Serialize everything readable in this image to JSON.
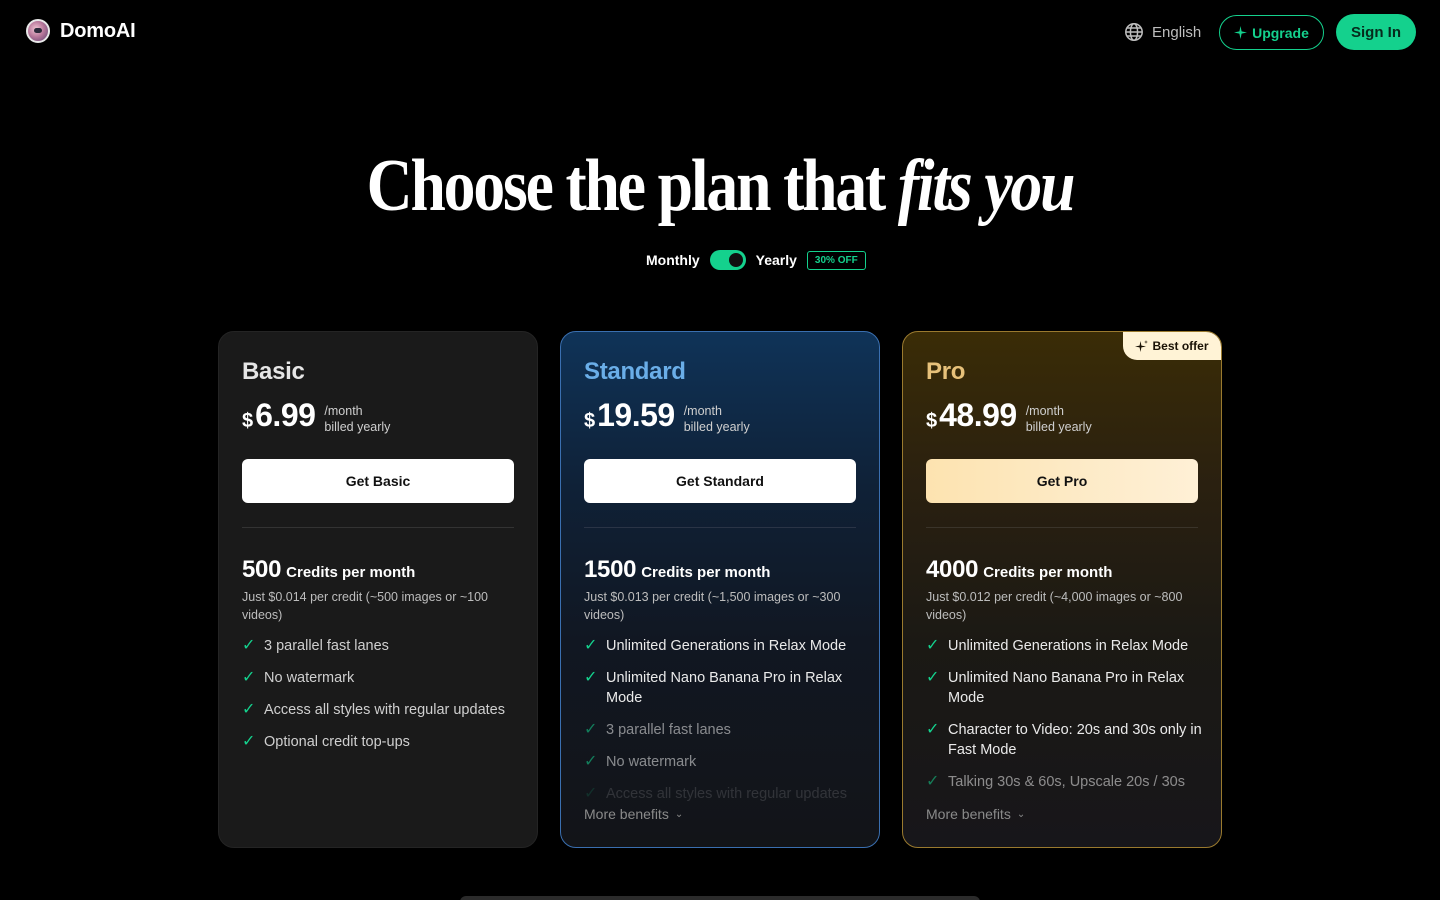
{
  "header": {
    "brand": "DomoAI",
    "language": "English",
    "upgrade_label": "Upgrade",
    "signin_label": "Sign In"
  },
  "hero": {
    "title_plain": "Choose the plan that ",
    "title_italic": "fits you"
  },
  "billing": {
    "monthly_label": "Monthly",
    "yearly_label": "Yearly",
    "discount_badge": "30% OFF",
    "yearly_selected": true
  },
  "plans": [
    {
      "name": "Basic",
      "currency": "$",
      "price": "6.99",
      "per": "/month",
      "billing": "billed yearly",
      "cta": "Get Basic",
      "credits": "500",
      "credits_label": "Credits per month",
      "credit_note": "Just $0.014 per credit (~500 images or ~100 videos)",
      "features": [
        "3 parallel fast lanes",
        "No watermark",
        "Access all styles with regular updates",
        "Optional credit top-ups"
      ]
    },
    {
      "name": "Standard",
      "currency": "$",
      "price": "19.59",
      "per": "/month",
      "billing": "billed yearly",
      "cta": "Get Standard",
      "credits": "1500",
      "credits_label": "Credits per month",
      "credit_note": "Just $0.013 per credit (~1,500 images or ~300 videos)",
      "features": [
        "Unlimited Generations in Relax Mode",
        "Unlimited Nano Banana Pro in Relax Mode",
        "3 parallel fast lanes",
        "No watermark",
        "Access all styles with regular updates"
      ],
      "more_label": "More benefits"
    },
    {
      "name": "Pro",
      "badge": "Best offer",
      "currency": "$",
      "price": "48.99",
      "per": "/month",
      "billing": "billed yearly",
      "cta": "Get Pro",
      "credits": "4000",
      "credits_label": "Credits per month",
      "credit_note": "Just $0.012 per credit (~4,000 images or ~800 videos)",
      "features": [
        "Unlimited Generations in Relax Mode",
        "Unlimited Nano Banana Pro in Relax Mode",
        "Character to Video: 20s and 30s only in Fast Mode",
        "Talking 30s & 60s, Upscale 20s / 30s"
      ],
      "more_label": "More benefits"
    }
  ],
  "colors": {
    "accent": "#14d18d",
    "standard_accent": "#6aaee8",
    "pro_accent": "#e7c17a",
    "background": "#000000"
  },
  "icons": {
    "logo": "domoai-avatar-icon",
    "language": "globe-icon",
    "upgrade": "sparkle-icon",
    "feature": "check-icon",
    "more": "chevron-down-icon",
    "badge": "sparkle-icon"
  }
}
